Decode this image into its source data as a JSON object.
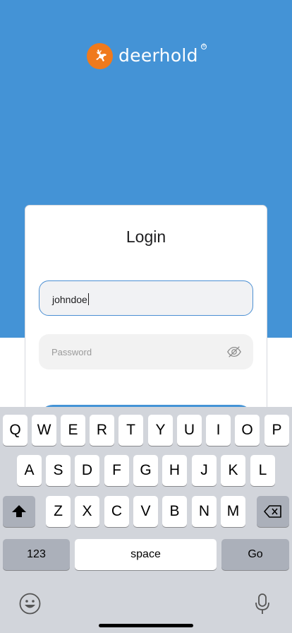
{
  "brand": {
    "name": "deerhold",
    "accent": "#f07a1c",
    "hero_color": "#4493d6"
  },
  "login": {
    "title": "Login",
    "username_value": "johndoe",
    "password_placeholder": "Password",
    "password_toggle_icon": "eye-off-icon"
  },
  "keyboard": {
    "row1": [
      "Q",
      "W",
      "E",
      "R",
      "T",
      "Y",
      "U",
      "I",
      "O",
      "P"
    ],
    "row2": [
      "A",
      "S",
      "D",
      "F",
      "G",
      "H",
      "J",
      "K",
      "L"
    ],
    "row3": [
      "Z",
      "X",
      "C",
      "V",
      "B",
      "N",
      "M"
    ],
    "shift_icon": "shift-icon",
    "delete_icon": "backspace-icon",
    "numbers_label": "123",
    "space_label": "space",
    "return_label": "Go",
    "emoji_icon": "emoji-icon",
    "dictation_icon": "microphone-icon"
  }
}
